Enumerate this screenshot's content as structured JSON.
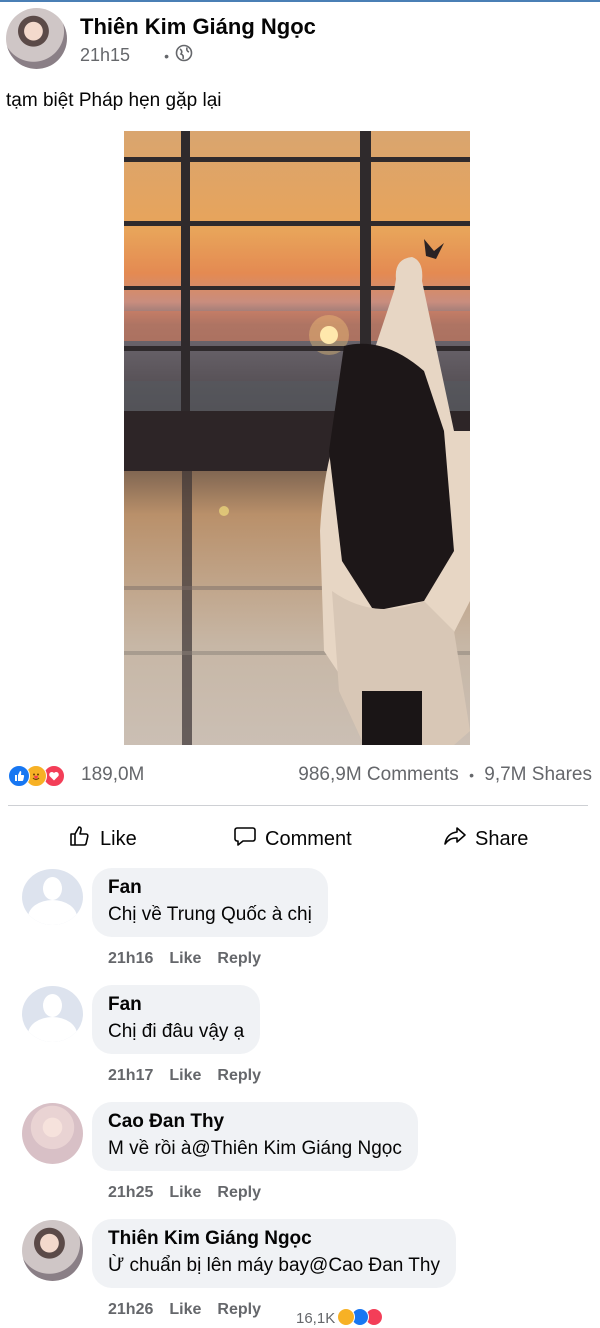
{
  "post": {
    "author": "Thiên Kim Giáng Ngọc",
    "time": "21h15",
    "separator": "•",
    "caption": "tạm biệt Pháp hẹn gặp lại"
  },
  "stats": {
    "reactions": "189,0M",
    "comments": "986,9M Comments",
    "dot": "•",
    "shares": "9,7M Shares"
  },
  "actions": {
    "like": "Like",
    "comment": "Comment",
    "share": "Share"
  },
  "comments": [
    {
      "name": "Fan",
      "text": "Chị về Trung Quốc à chị",
      "time": "21h16",
      "like": "Like",
      "reply": "Reply"
    },
    {
      "name": "Fan",
      "text": "Chị đi đâu vậy ạ",
      "time": "21h17",
      "like": "Like",
      "reply": "Reply"
    },
    {
      "name": "Cao Đan Thy",
      "text": "M về rồi à@Thiên Kim Giáng Ngọc",
      "time": "21h25",
      "like": "Like",
      "reply": "Reply"
    },
    {
      "name": "Thiên Kim Giáng Ngọc",
      "text": "Ừ chuẩn bị lên máy bay@Cao Đan Thy",
      "time": "21h26",
      "like": "Like",
      "reply": "Reply",
      "reaction_count": "16,1K"
    }
  ],
  "colors": {
    "like_blue": "#1877f2",
    "love_red": "#f33e58",
    "care_yellow": "#f7b125",
    "secondary_text": "#65676b",
    "bubble_bg": "#f0f2f5"
  },
  "icons": [
    "globe-icon",
    "like-reaction-icon",
    "care-reaction-icon",
    "love-reaction-icon",
    "thumbs-up-icon",
    "comment-icon",
    "share-icon"
  ]
}
